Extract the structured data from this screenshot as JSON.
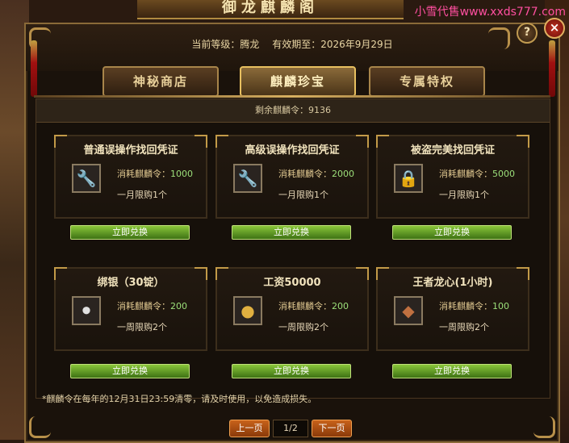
{
  "banner": {
    "title": "御龙麒麟阁",
    "watermark": "小雪代售www.xxds777.com"
  },
  "header": {
    "level_label": "当前等级：腾龙",
    "expiry_label": "有效期至：2026年9月29日"
  },
  "tabs": [
    {
      "label": "神秘商店",
      "active": false
    },
    {
      "label": "麒麟珍宝",
      "active": true
    },
    {
      "label": "专属特权",
      "active": false
    }
  ],
  "remaining": "剩余麒麟令：9136",
  "items": [
    {
      "title": "普通误操作找回凭证",
      "cost_prefix": "消耗麒麟令：",
      "cost": "1000",
      "limit": "一月限购1个",
      "icon": "wrench-icon",
      "button": "立即兑换"
    },
    {
      "title": "高级误操作找回凭证",
      "cost_prefix": "消耗麒麟令：",
      "cost": "2000",
      "limit": "一月限购1个",
      "icon": "wrench-icon",
      "button": "立即兑换"
    },
    {
      "title": "被盗完美找回凭证",
      "cost_prefix": "消耗麒麟令：",
      "cost": "5000",
      "limit": "一月限购1个",
      "icon": "lock-icon",
      "button": "立即兑换"
    },
    {
      "title": "绑银（30锭）",
      "cost_prefix": "消耗麒麟令：",
      "cost": "200",
      "limit": "一周限购2个",
      "icon": "silver-ingot-icon",
      "button": "立即兑换"
    },
    {
      "title": "工资50000",
      "cost_prefix": "消耗麒麟令：",
      "cost": "200",
      "limit": "一周限购2个",
      "icon": "gold-money-icon",
      "button": "立即兑换"
    },
    {
      "title": "王者龙心(1小时)",
      "cost_prefix": "消耗麒麟令：",
      "cost": "100",
      "limit": "一周限购2个",
      "icon": "dragon-head-icon",
      "button": "立即兑换"
    }
  ],
  "note": "*麒麟令在每年的12月31日23:59清零，请及时使用，以免造成损失。",
  "pager": {
    "prev": "上一页",
    "page": "1/2",
    "next": "下一页"
  },
  "controls": {
    "help": "?",
    "close": "×"
  }
}
